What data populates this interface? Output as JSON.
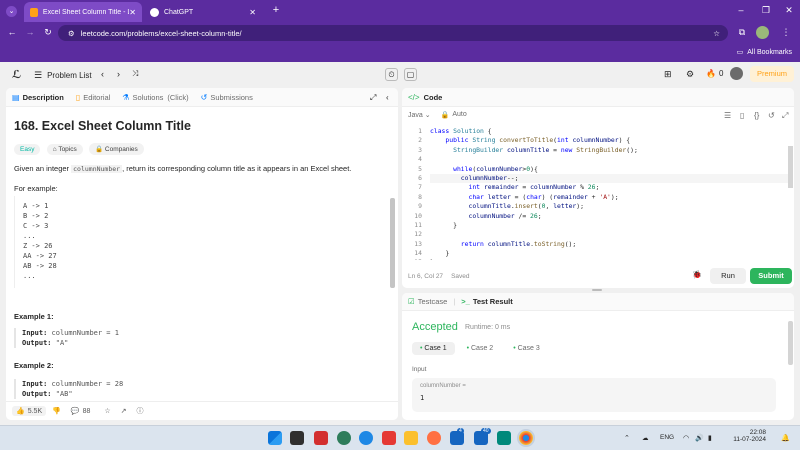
{
  "browser": {
    "tabs": [
      {
        "label": "Excel Sheet Column Title - Leet",
        "active": true
      },
      {
        "label": "ChatGPT",
        "active": false
      }
    ],
    "url": "leetcode.com/problems/excel-sheet-column-title/",
    "bookmarks_label": "All Bookmarks",
    "accent": "#5b2c9f"
  },
  "nav": {
    "problem_list": "Problem List",
    "streak": "0",
    "premium": "Premium"
  },
  "left": {
    "tabs": [
      "Description",
      "Editorial",
      "Solutions",
      "(Click)",
      "Submissions"
    ],
    "title": "168. Excel Sheet Column Title",
    "chips": [
      "Easy",
      "Topics",
      "Companies"
    ],
    "desc_pre": "Given an integer ",
    "desc_code": "columnNumber",
    "desc_post": ", return its corresponding column title as it appears in an Excel sheet.",
    "for_example": "For example:",
    "mapping": [
      "A -> 1",
      "B -> 2",
      "C -> 3",
      "...",
      "Z -> 26",
      "AA -> 27",
      "AB -> 28",
      "..."
    ],
    "ex1_title": "Example 1:",
    "ex1_input_label": "Input:",
    "ex1_input": " columnNumber = 1",
    "ex1_output_label": "Output:",
    "ex1_output": " \"A\"",
    "ex2_title": "Example 2:",
    "ex2_input_label": "Input:",
    "ex2_input": " columnNumber = 28",
    "ex2_output_label": "Output:",
    "ex2_output": " \"AB\"",
    "likes": "5.5K",
    "comments": "88"
  },
  "code": {
    "header": "Code",
    "language": "Java",
    "mode": "Auto",
    "status": "Ln 6, Col 27",
    "saved": "Saved",
    "run": "Run",
    "submit": "Submit",
    "line_numbers": [
      "1",
      "2",
      "3",
      "4",
      "5",
      "6",
      "7",
      "8",
      "9",
      "10",
      "11",
      "12",
      "13",
      "14",
      "15"
    ]
  },
  "result": {
    "tab_testcase": "Testcase",
    "tab_result": "Test Result",
    "accepted": "Accepted",
    "runtime": "Runtime: 0 ms",
    "cases": [
      "Case 1",
      "Case 2",
      "Case 3"
    ],
    "input_label": "Input",
    "var_name": "columnNumber =",
    "var_value": "1",
    "accepted_color": "#2db55d"
  },
  "taskbar": {
    "badge1": "4",
    "badge2": "40",
    "lang": "ENG",
    "time": "22:08",
    "date": "11-07-2024"
  }
}
